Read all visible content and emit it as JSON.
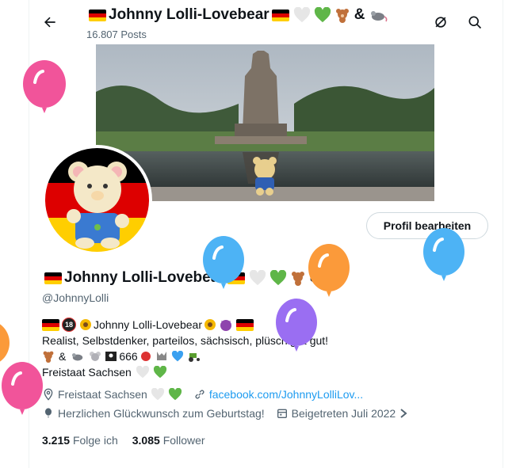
{
  "header": {
    "title": "Johnny Lolli-Lovebear",
    "post_count": "16.807 Posts"
  },
  "profile": {
    "display_name": "Johnny Lolli-Lovebear",
    "handle": "@JohnnyLolli",
    "edit_button": "Profil bearbeiten",
    "bio": {
      "line1_name": "Johnny Lolli-Lovebear",
      "line1_badge": "18",
      "line2": "Realist, Selbstdenker, parteilos, sächsisch, plüschig & gut!",
      "line3_amp": "&",
      "line3_number": "666",
      "line4": "Freistaat Sachsen"
    },
    "location": "Freistaat Sachsen",
    "website": "facebook.com/JohnnyLolliLov...",
    "birthday": "Herzlichen Glückwunsch zum Geburtstag!",
    "joined": "Beigetreten Juli 2022",
    "following_count": "3.215",
    "following_label": "Folge ich",
    "followers_count": "3.085",
    "followers_label": "Follower"
  },
  "title_amp": "&",
  "icons": {
    "back": "arrow-left-icon",
    "no_grok": "circle-slash-icon",
    "search": "search-icon",
    "location": "location-pin-icon",
    "link": "link-icon",
    "birthday": "balloon-icon",
    "calendar": "calendar-icon"
  },
  "colors": {
    "accent": "#1d9bf0",
    "text": "#0f1419",
    "muted": "#536471",
    "flag_black": "#000000",
    "flag_red": "#dd0000",
    "flag_gold": "#ffce00",
    "heart_white": "#e6e6e6",
    "heart_green": "#5fb648"
  }
}
